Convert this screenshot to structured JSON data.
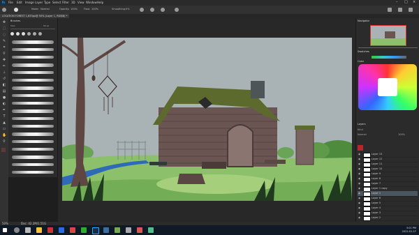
{
  "menubar": {
    "app_icon": "Ps",
    "items": [
      "File",
      "Edit",
      "Image",
      "Layer",
      "Type",
      "Select",
      "Filter",
      "3D",
      "View",
      "Window",
      "Help"
    ],
    "window_controls": [
      "–",
      "□",
      "×"
    ]
  },
  "options": {
    "mode_label": "Mode:",
    "mode_value": "Normal",
    "opacity_label": "Opacity:",
    "opacity_value": "100%",
    "flow_label": "Flow:",
    "flow_value": "100%",
    "smoothing_label": "Smoothing:",
    "smoothing_value": "0%"
  },
  "document": {
    "tab_title": "LOCATION FOREST 1,833px@ 50% (Layer 1, RGB/8) *"
  },
  "brush_panel": {
    "title": "Brushes",
    "size_label": "Size:",
    "size_value": "60 px",
    "stroke_count": 18
  },
  "right_dock": {
    "navigator_title": "Navigator",
    "color_title": "Color",
    "swatches_title": "Swatches",
    "layers_title": "Layers",
    "kind_label": "Kind",
    "mode": "Normal",
    "opacity": "100%",
    "layers": [
      {
        "name": "Layer 13",
        "selected": false
      },
      {
        "name": "Layer 12",
        "selected": false
      },
      {
        "name": "Layer 11",
        "selected": false
      },
      {
        "name": "Layer 10",
        "selected": false
      },
      {
        "name": "Layer 9",
        "selected": false
      },
      {
        "name": "Layer 8",
        "selected": false
      },
      {
        "name": "Layer 7",
        "selected": false
      },
      {
        "name": "Layer 1 copy",
        "selected": false
      },
      {
        "name": "Layer 1",
        "selected": true
      },
      {
        "name": "Layer 6",
        "selected": false
      },
      {
        "name": "Layer 5",
        "selected": false
      },
      {
        "name": "Layer 4",
        "selected": false
      },
      {
        "name": "Layer 3",
        "selected": false
      },
      {
        "name": "Layer 2",
        "selected": false
      }
    ]
  },
  "status": {
    "zoom": "50%",
    "doc_size": "Doc: 42.2M/1.51G"
  },
  "taskbar": {
    "time": "3:01 PM",
    "date": "2022-01-27"
  },
  "colors": {
    "sky": "#a9b2b4",
    "grass": "#8dc06a",
    "cabin": "#6b5552",
    "moss": "#5c6a2e",
    "accent": "#31a8ff"
  }
}
